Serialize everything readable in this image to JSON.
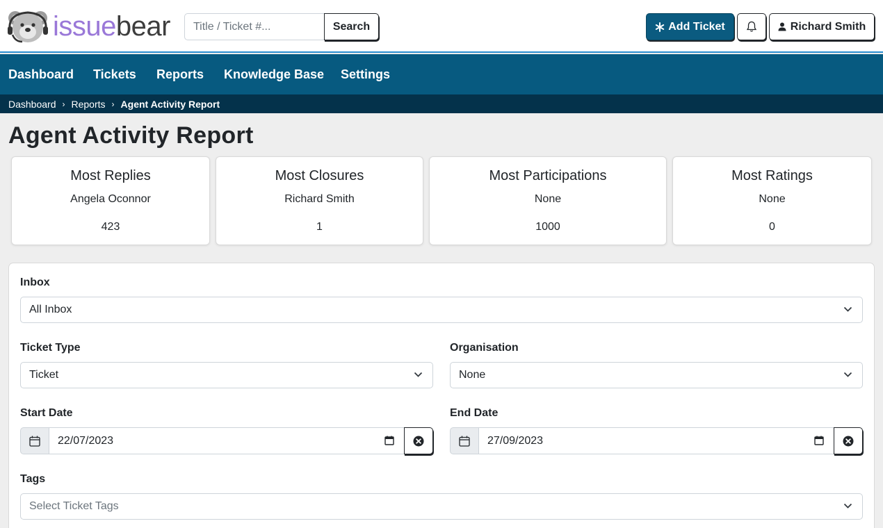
{
  "brand": {
    "logo_part1": "issue",
    "logo_part2": "bear",
    "accent": "#9a78d8"
  },
  "header": {
    "search_placeholder": "Title / Ticket #...",
    "search_button": "Search",
    "add_ticket_label": "Add Ticket",
    "user_name": "Richard Smith"
  },
  "nav": {
    "items": [
      {
        "label": "Dashboard"
      },
      {
        "label": "Tickets"
      },
      {
        "label": "Reports"
      },
      {
        "label": "Knowledge Base"
      },
      {
        "label": "Settings"
      }
    ],
    "background": "#075a80"
  },
  "breadcrumb": {
    "items": [
      {
        "label": "Dashboard"
      },
      {
        "label": "Reports"
      },
      {
        "label": "Agent Activity Report"
      }
    ]
  },
  "page": {
    "title": "Agent Activity Report"
  },
  "stats": [
    {
      "title": "Most Replies",
      "name": "Angela Oconnor",
      "value": "423"
    },
    {
      "title": "Most Closures",
      "name": "Richard Smith",
      "value": "1"
    },
    {
      "title": "Most Participations",
      "name": "None",
      "value": "1000"
    },
    {
      "title": "Most Ratings",
      "name": "None",
      "value": "0"
    }
  ],
  "filters": {
    "inbox": {
      "label": "Inbox",
      "value": "All Inbox"
    },
    "ticket_type": {
      "label": "Ticket Type",
      "value": "Ticket"
    },
    "organisation": {
      "label": "Organisation",
      "value": "None"
    },
    "start_date": {
      "label": "Start Date",
      "value": "22/07/2023"
    },
    "end_date": {
      "label": "End Date",
      "value": "27/09/2023"
    },
    "tags": {
      "label": "Tags",
      "placeholder": "Select Ticket Tags"
    }
  }
}
